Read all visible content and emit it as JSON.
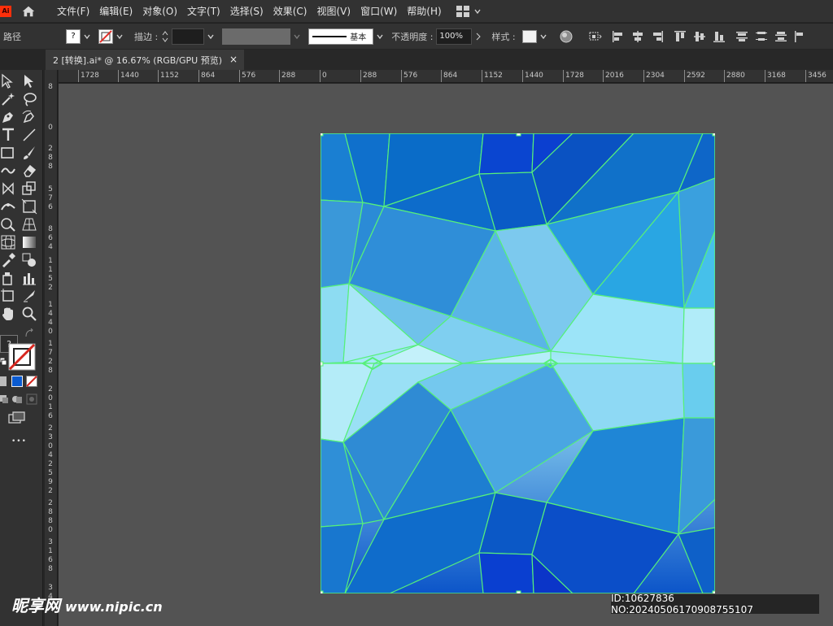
{
  "app": {
    "logo_text": "Ai"
  },
  "menus": [
    "文件(F)",
    "编辑(E)",
    "对象(O)",
    "文字(T)",
    "选择(S)",
    "效果(C)",
    "视图(V)",
    "窗口(W)",
    "帮助(H)"
  ],
  "control_bar": {
    "selection_label": "路径",
    "stroke_label": "描边 :",
    "brush_label": "基本",
    "opacity_label": "不透明度 :",
    "opacity_value": "100%",
    "style_label": "样式 :"
  },
  "document_tab": {
    "title": "2 [转换].ai* @ 16.67% (RGB/GPU 预览)",
    "close": "×"
  },
  "ruler": {
    "horizontal": [
      "1728",
      "1440",
      "1152",
      "864",
      "576",
      "288",
      "0",
      "288",
      "576",
      "864",
      "1152",
      "1440",
      "1728",
      "2016",
      "2304",
      "2592",
      "2880",
      "3168",
      "3456"
    ],
    "vertical": [
      "8",
      "0",
      "2\n8\n8",
      "5\n7\n6",
      "8\n6\n4",
      "1\n1\n5\n2",
      "1\n4\n4\n0",
      "1\n7\n2\n8",
      "2\n0\n1\n6",
      "2\n3\n0\n4",
      "2\n5\n9\n2",
      "2\n8\n8\n0",
      "3\n1\n6\n8",
      "3\n4"
    ]
  },
  "tools": {
    "unknown_swatch": "?",
    "more": "•••"
  },
  "watermark": {
    "site": "昵享网",
    "url": "www.nipic.cn",
    "id_text": "ID:10627836 NO:20240506170908755107"
  },
  "colors": {
    "artwork_dark_blue": "#0a3fc8",
    "artwork_mid_blue": "#1f86d4",
    "artwork_light_cyan": "#b5f2fb",
    "selection_green": "#56f07a"
  }
}
